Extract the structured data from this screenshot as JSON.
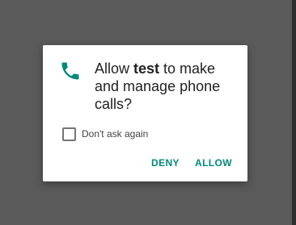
{
  "dialog": {
    "message_prefix": "Allow ",
    "app_name": "test",
    "message_suffix": " to make and manage phone calls?",
    "icon": "phone-icon",
    "checkbox_label": "Don't ask again",
    "checkbox_checked": false,
    "deny_label": "DENY",
    "allow_label": "ALLOW"
  },
  "colors": {
    "accent": "#00897b",
    "scrim": "#5a5a5a",
    "dialog_bg": "#ffffff"
  }
}
